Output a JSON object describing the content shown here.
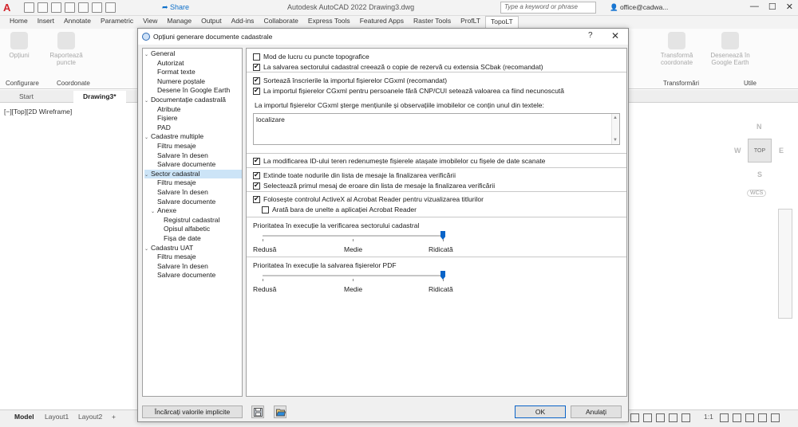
{
  "app": {
    "title": "Autodesk AutoCAD 2022    Drawing3.dwg",
    "share_label": "Share",
    "search_placeholder": "Type a keyword or phrase",
    "user": "office@cadwa..."
  },
  "ribbon": {
    "tabs": [
      "Home",
      "Insert",
      "Annotate",
      "Parametric",
      "View",
      "Manage",
      "Output",
      "Add-ins",
      "Collaborate",
      "Express Tools",
      "Featured Apps",
      "Raster Tools",
      "ProfLT",
      "TopoLT"
    ],
    "active_tab": "TopoLT",
    "buttons": [
      {
        "label": "Opțiuni"
      },
      {
        "label": "Raportează puncte"
      },
      {
        "label": "Transformă coordonate"
      },
      {
        "label": "Desenează în Google Earth"
      }
    ],
    "panels": [
      "Configurare",
      "Coordonate",
      "Transformări",
      "Utile"
    ]
  },
  "doc_tabs": [
    "Start",
    "Drawing3*"
  ],
  "viewport_label": "[−][Top][2D Wireframe]",
  "viewcube": {
    "top": "TOP",
    "n": "N",
    "s": "S",
    "e": "E",
    "w": "W",
    "wcs": "WCS"
  },
  "layout_tabs": [
    "Model",
    "Layout1",
    "Layout2"
  ],
  "status_scale": "1:1",
  "dialog": {
    "title": "Opțiuni generare documente cadastrale",
    "help": "?",
    "close": "✕",
    "tree": [
      {
        "label": "General",
        "level": 0,
        "expanded": true
      },
      {
        "label": "Autorizat",
        "level": 1
      },
      {
        "label": "Format texte",
        "level": 1
      },
      {
        "label": "Numere poștale",
        "level": 1
      },
      {
        "label": "Desene în Google Earth",
        "level": 1
      },
      {
        "label": "Documentație cadastrală",
        "level": 0,
        "expanded": true
      },
      {
        "label": "Atribute",
        "level": 1
      },
      {
        "label": "Fișiere",
        "level": 1
      },
      {
        "label": "PAD",
        "level": 1
      },
      {
        "label": "Cadastre multiple",
        "level": 0,
        "expanded": true
      },
      {
        "label": "Filtru mesaje",
        "level": 1
      },
      {
        "label": "Salvare în desen",
        "level": 1
      },
      {
        "label": "Salvare documente",
        "level": 1
      },
      {
        "label": "Sector cadastral",
        "level": 0,
        "expanded": true,
        "selected": true
      },
      {
        "label": "Filtru mesaje",
        "level": 1
      },
      {
        "label": "Salvare în desen",
        "level": 1
      },
      {
        "label": "Salvare documente",
        "level": 1
      },
      {
        "label": "Anexe",
        "level": 1,
        "expanded": true
      },
      {
        "label": "Registrul cadastral",
        "level": 2
      },
      {
        "label": "Opisul alfabetic",
        "level": 2
      },
      {
        "label": "Fișa de date",
        "level": 2
      },
      {
        "label": "Cadastru UAT",
        "level": 0,
        "expanded": true
      },
      {
        "label": "Filtru mesaje",
        "level": 1
      },
      {
        "label": "Salvare în desen",
        "level": 1
      },
      {
        "label": "Salvare documente",
        "level": 1
      }
    ],
    "options": {
      "mod_lucru": {
        "label": "Mod de lucru cu puncte topografice",
        "checked": false
      },
      "copie_rezerva": {
        "label": "La salvarea sectorului cadastral creează o copie de rezervă cu extensia SCbak (recomandat)",
        "checked": true
      },
      "sorteaza": {
        "label": "Sortează înscrierile la importul fișierelor CGxml (recomandat)",
        "checked": true
      },
      "cnp_cui": {
        "label": "La importul fișierelor CGxml pentru persoanele fără CNP/CUI setează valoarea ca fiind necunoscută",
        "checked": true
      },
      "sterge_label": "La importul fișierelor CGxml șterge mențiunile și observațiile imobilelor ce conțin unul din textele:",
      "sterge_text": "localizare",
      "modificarea_id": {
        "label": "La modificarea ID-ului teren redenumește fișierele atașate imobilelor cu fișele de date scanate",
        "checked": true
      },
      "extinde": {
        "label": "Extinde toate nodurile din lista de mesaje la finalizarea verificării",
        "checked": true
      },
      "selecteaza": {
        "label": "Selectează primul mesaj de eroare din lista de mesaje la finalizarea verificării",
        "checked": true
      },
      "activex": {
        "label": "Folosește controlul ActiveX al Acrobat Reader pentru vizualizarea titlurilor",
        "checked": true
      },
      "bara_unelte": {
        "label": "Arată bara de unelte a aplicației Acrobat Reader",
        "checked": false
      }
    },
    "slider_verificare": {
      "label": "Prioritatea în execuție la verificarea sectorului cadastral",
      "value": 1.0,
      "low": "Redusă",
      "mid": "Medie",
      "high": "Ridicată"
    },
    "slider_pdf": {
      "label": "Prioritatea în execuție la salvarea fișierelor PDF",
      "value": 1.0,
      "low": "Redusă",
      "mid": "Medie",
      "high": "Ridicată"
    },
    "buttons": {
      "defaults": "Încărcați valorile implicite",
      "ok": "OK",
      "cancel": "Anulați"
    }
  }
}
